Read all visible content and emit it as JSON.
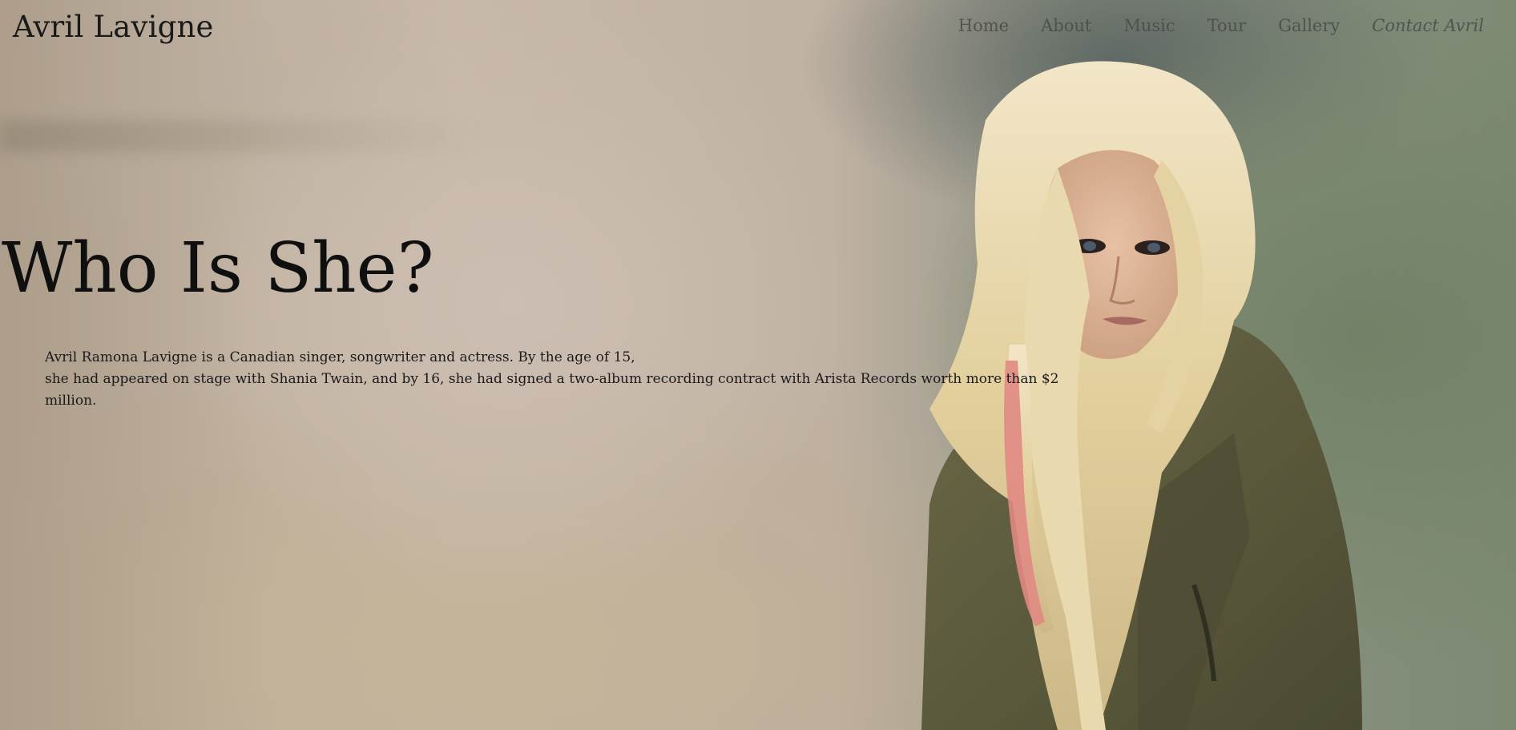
{
  "site": {
    "brand": "Avril Lavigne"
  },
  "nav": {
    "items": [
      {
        "label": "Home"
      },
      {
        "label": "About"
      },
      {
        "label": "Music"
      },
      {
        "label": "Tour"
      },
      {
        "label": "Gallery"
      },
      {
        "label": "Contact Avril"
      }
    ]
  },
  "hero": {
    "title": "Who Is She?",
    "text_line1": "Avril Ramona Lavigne is a Canadian singer, songwriter and actress. By the age of 15,",
    "text_line2": "she had appeared on stage with Shania Twain, and by 16, she had signed a two-album recording contract with Arista Records worth more than $2 million."
  },
  "colors": {
    "text": "#1a1a1a",
    "nav_text": "#4a4a4a",
    "jacket": "#5b5a3e",
    "hair": "#e6d4a6",
    "hair_streak": "#e08a82"
  }
}
